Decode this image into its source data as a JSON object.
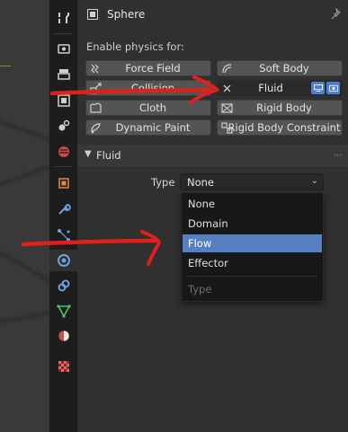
{
  "header": {
    "object_name": "Sphere"
  },
  "physics": {
    "title": "Enable physics for:",
    "buttons": [
      {
        "label": "Force Field",
        "icon": "force-field-icon",
        "enabled": false
      },
      {
        "label": "Soft Body",
        "icon": "soft-body-icon",
        "enabled": false
      },
      {
        "label": "Collision",
        "icon": "collision-icon",
        "enabled": false
      },
      {
        "label": "Fluid",
        "icon": "close-x-icon",
        "enabled": true
      },
      {
        "label": "Cloth",
        "icon": "cloth-icon",
        "enabled": false
      },
      {
        "label": "Rigid Body",
        "icon": "rigid-body-icon",
        "enabled": false
      },
      {
        "label": "Dynamic Paint",
        "icon": "dynamic-paint-icon",
        "enabled": false
      },
      {
        "label": "Rigid Body Constraint",
        "icon": "rigid-body-constraint-icon",
        "enabled": false
      }
    ]
  },
  "fluid_section": {
    "title": "Fluid",
    "type_label": "Type",
    "type_value": "None",
    "menu_items": [
      "None",
      "Domain",
      "Flow",
      "Effector"
    ],
    "highlighted": "Flow",
    "menu_footer": "Type"
  },
  "sidebar": {
    "tabs": [
      "tool-icon",
      "render-icon",
      "output-icon",
      "view-layer-icon",
      "scene-icon",
      "world-icon",
      "object-icon",
      "modifier-icon",
      "particles-icon",
      "physics-icon",
      "constraints-icon",
      "data-icon",
      "material-icon",
      "texture-icon"
    ],
    "active": "physics-icon"
  },
  "colors": {
    "accent_blue": "#5680c2",
    "annotation_red": "#e0201c",
    "panel_bg": "#303030"
  }
}
